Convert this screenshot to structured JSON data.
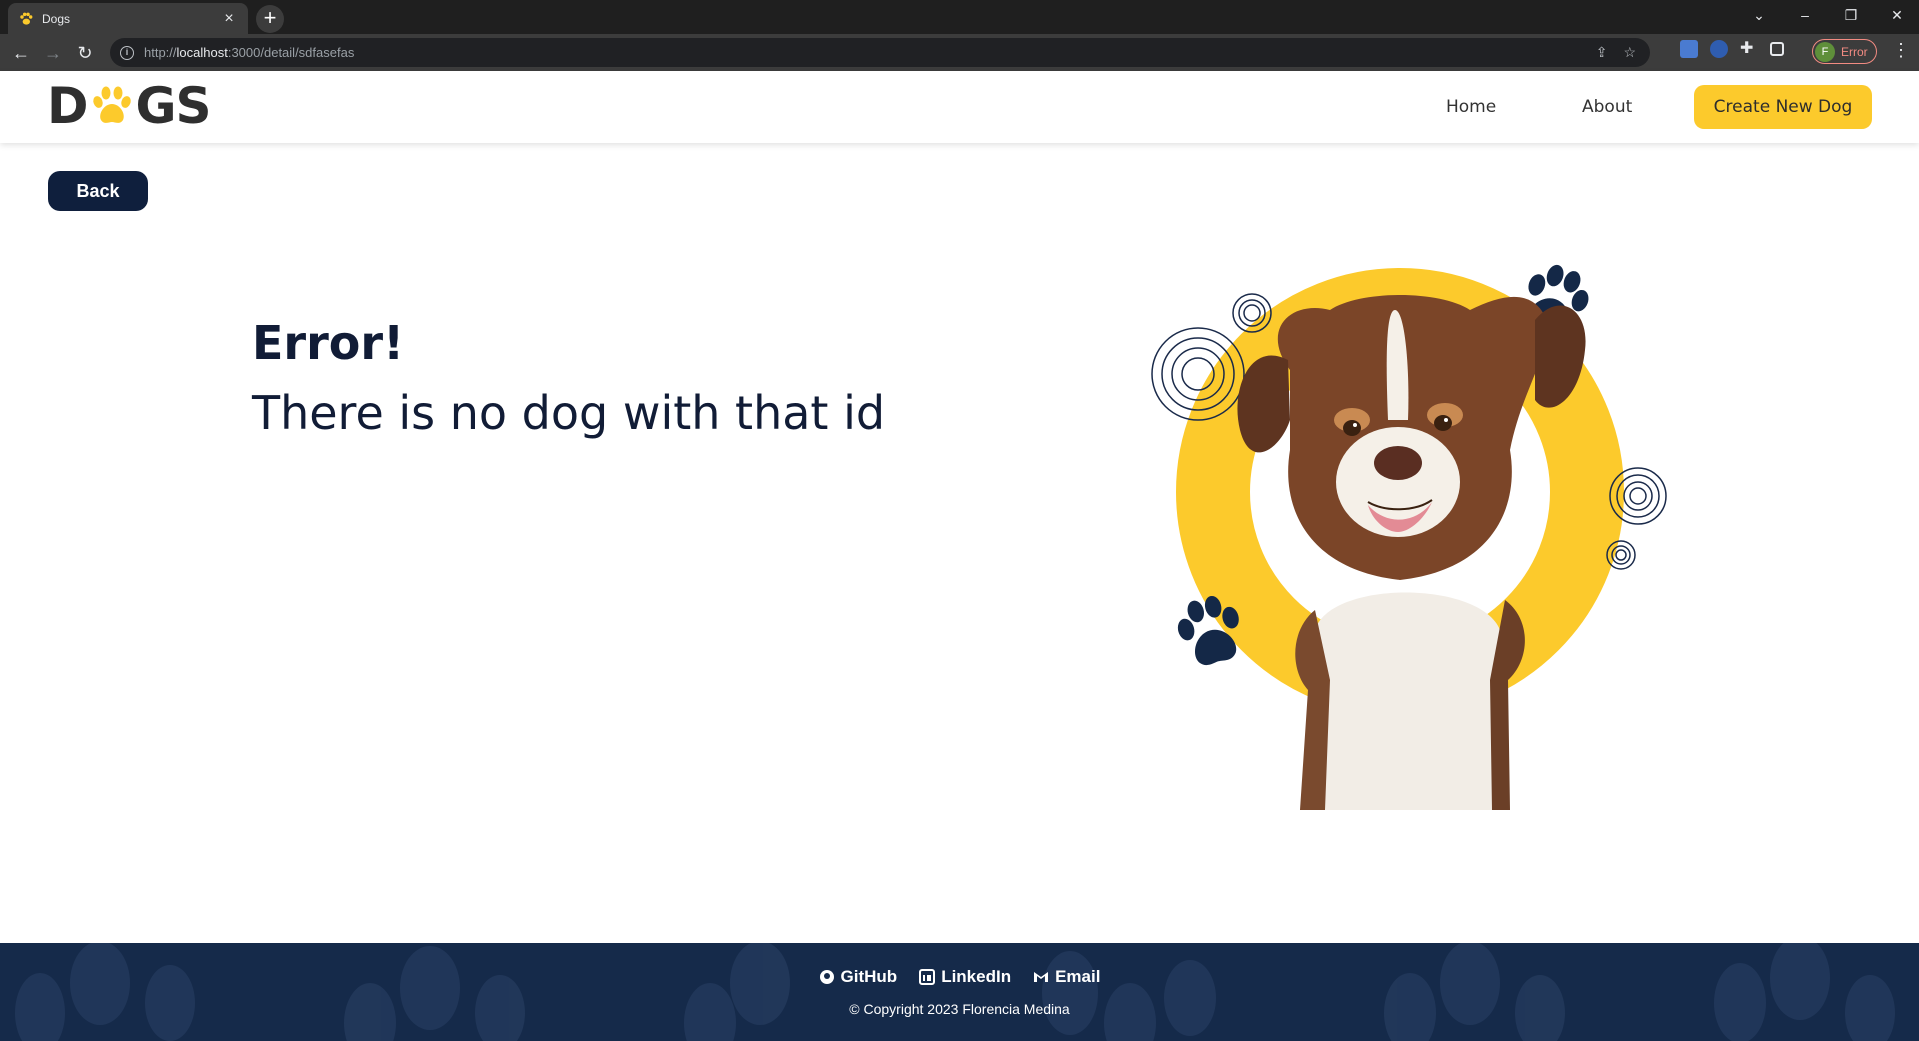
{
  "browser": {
    "tab_title": "Dogs",
    "url_prefix": "http://",
    "url_host": "localhost",
    "url_rest": ":3000/detail/sdfasefas",
    "profile_initial": "F",
    "profile_status": "Error"
  },
  "header": {
    "logo_left": "D",
    "logo_right": "GS",
    "nav": {
      "home": "Home",
      "about": "About",
      "create": "Create New Dog"
    }
  },
  "main": {
    "back_label": "Back",
    "error_title": "Error!",
    "error_message": "There is no dog with that id"
  },
  "footer": {
    "github": "GitHub",
    "linkedin": "LinkedIn",
    "email": "Email",
    "copyright": "© Copyright 2023 Florencia Medina"
  },
  "colors": {
    "accent": "#fcca2c",
    "navy": "#0f1f3d",
    "footer_bg": "#152a4a"
  }
}
